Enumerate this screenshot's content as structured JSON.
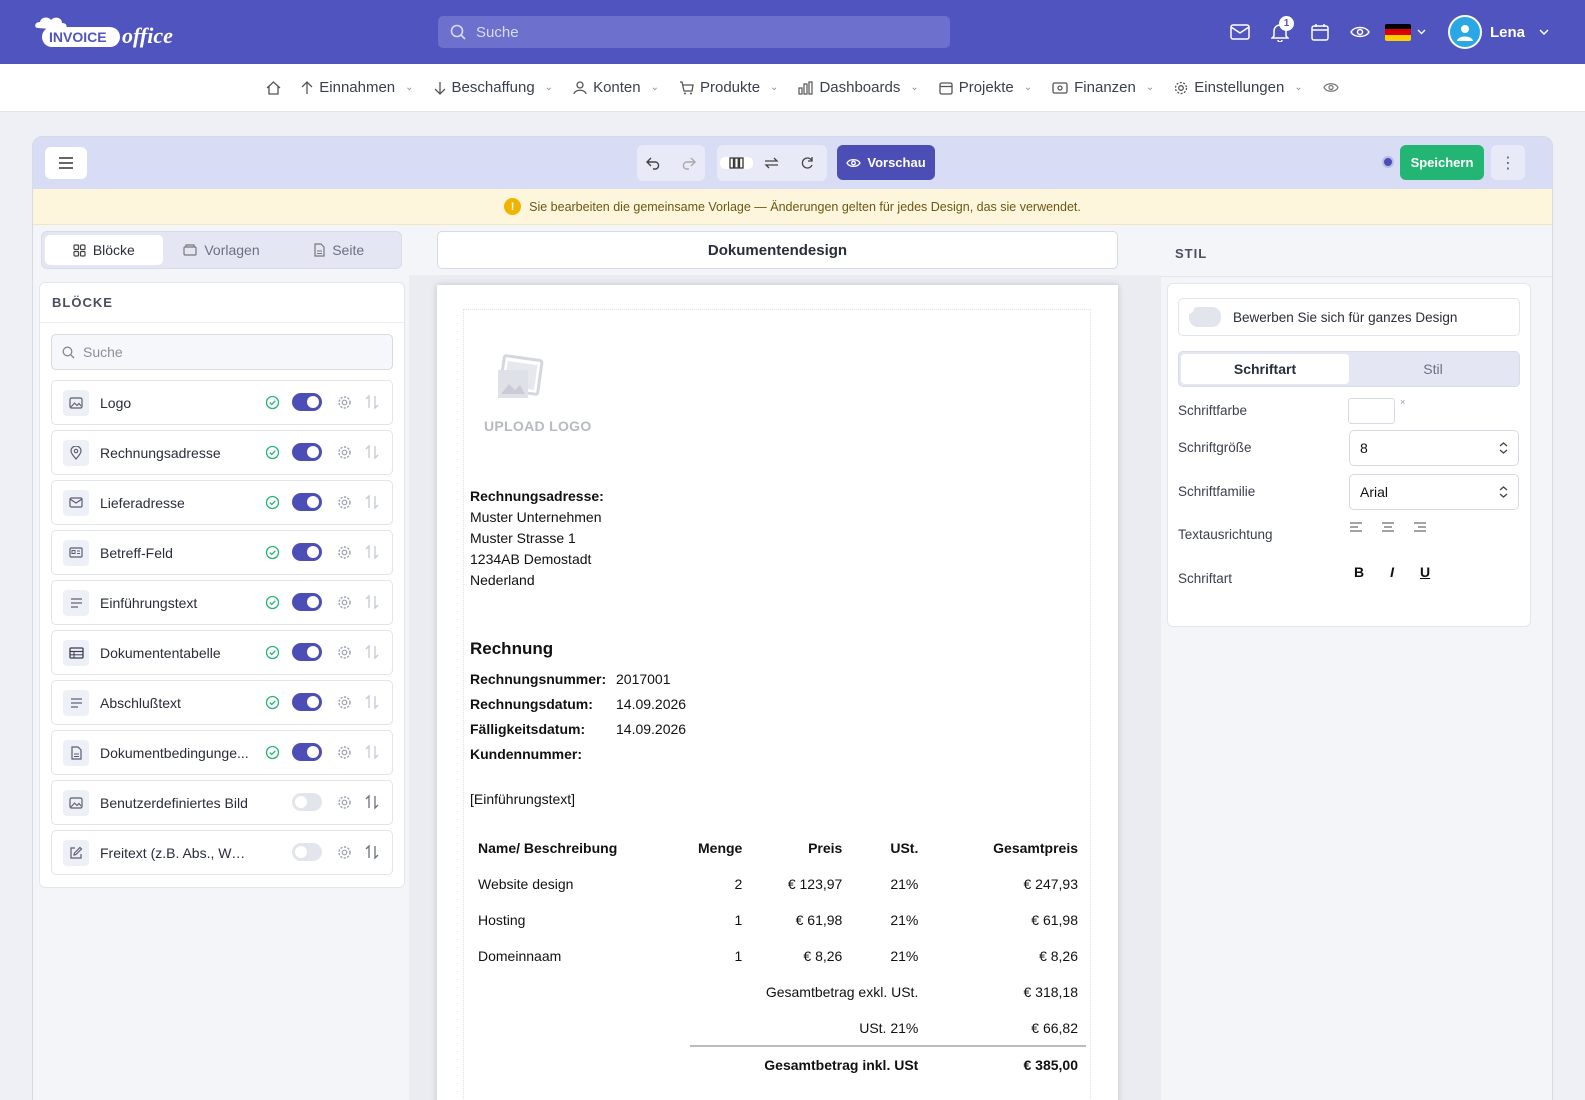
{
  "header": {
    "logo_text": "INVOICEoffice",
    "search_placeholder": "Suche",
    "notification_count": "1",
    "user_name": "Lena"
  },
  "nav": [
    {
      "label": "Einnahmen",
      "icon": "arrow-up-icon"
    },
    {
      "label": "Beschaffung",
      "icon": "arrow-down-icon"
    },
    {
      "label": "Konten",
      "icon": "user-icon"
    },
    {
      "label": "Produkte",
      "icon": "cart-icon"
    },
    {
      "label": "Dashboards",
      "icon": "bar-chart-icon"
    },
    {
      "label": "Projekte",
      "icon": "calendar-icon"
    },
    {
      "label": "Finanzen",
      "icon": "money-icon"
    },
    {
      "label": "Einstellungen",
      "icon": "gear-icon"
    }
  ],
  "toolbar": {
    "preview_label": "Vorschau",
    "save_label": "Speichern"
  },
  "warning": "Sie bearbeiten die gemeinsame Vorlage — Änderungen gelten für jedes Design, das sie verwendet.",
  "left_tabs": [
    "Blöcke",
    "Vorlagen",
    "Seite"
  ],
  "blocks_panel": {
    "title": "BLÖCKE",
    "search_placeholder": "Suche",
    "items": [
      {
        "label": "Logo",
        "enabled": true,
        "icon": "image-icon"
      },
      {
        "label": "Rechnungsadresse",
        "enabled": true,
        "icon": "location-pin-icon"
      },
      {
        "label": "Lieferadresse",
        "enabled": true,
        "icon": "envelope-icon"
      },
      {
        "label": "Betreff-Feld",
        "enabled": true,
        "icon": "id-card-icon"
      },
      {
        "label": "Einführungstext",
        "enabled": true,
        "icon": "text-lines-icon"
      },
      {
        "label": "Dokumententabelle",
        "enabled": true,
        "icon": "table-icon"
      },
      {
        "label": "Abschlußtext",
        "enabled": true,
        "icon": "text-lines-icon"
      },
      {
        "label": "Dokumentbedingunge...",
        "enabled": true,
        "icon": "document-icon"
      },
      {
        "label": "Benutzerdefiniertes Bild",
        "enabled": false,
        "icon": "image-icon"
      },
      {
        "label": "Freitext (z.B. Abs., Werbete...",
        "enabled": false,
        "icon": "edit-icon"
      }
    ]
  },
  "document": {
    "title": "Dokumentendesign",
    "upload_logo": "UPLOAD LOGO",
    "address_label": "Rechnungsadresse:",
    "address_lines": [
      "Muster Unternehmen",
      "Muster Strasse 1",
      "1234AB Demostadt",
      "Nederland"
    ],
    "invoice_title": "Rechnung",
    "meta": [
      {
        "label": "Rechnungsnummer:",
        "value": "2017001"
      },
      {
        "label": "Rechnungsdatum:",
        "value": "14.09.2026"
      },
      {
        "label": "Fälligkeitsdatum:",
        "value": "14.09.2026"
      },
      {
        "label": "Kundennummer:",
        "value": ""
      }
    ],
    "intro": "[Einführungstext]",
    "table": {
      "headers": [
        "Name/ Beschreibung",
        "Menge",
        "Preis",
        "USt.",
        "Gesamtpreis"
      ],
      "rows": [
        [
          "Website design",
          "2",
          "€ 123,97",
          "21%",
          "€ 247,93"
        ],
        [
          "Hosting",
          "1",
          "€ 61,98",
          "21%",
          "€ 61,98"
        ],
        [
          "Domeinnaam",
          "1",
          "€ 8,26",
          "21%",
          "€ 8,26"
        ]
      ],
      "subtotal_label": "Gesamtbetrag exkl. USt.",
      "subtotal_value": "€ 318,18",
      "tax_label": "USt. 21%",
      "tax_value": "€ 66,82",
      "total_label": "Gesamtbetrag inkl. USt",
      "total_value": "€ 385,00"
    }
  },
  "style_panel": {
    "header": "STIL",
    "apply_label": "Bewerben Sie sich für ganzes Design",
    "tabs": [
      "Schriftart",
      "Stil"
    ],
    "font_color_label": "Schriftfarbe",
    "font_size_label": "Schriftgröße",
    "font_size_value": "8",
    "font_family_label": "Schriftfamilie",
    "font_family_value": "Arial",
    "text_align_label": "Textausrichtung",
    "font_style_label": "Schriftart",
    "bold": "B",
    "italic": "I",
    "underline": "U"
  }
}
